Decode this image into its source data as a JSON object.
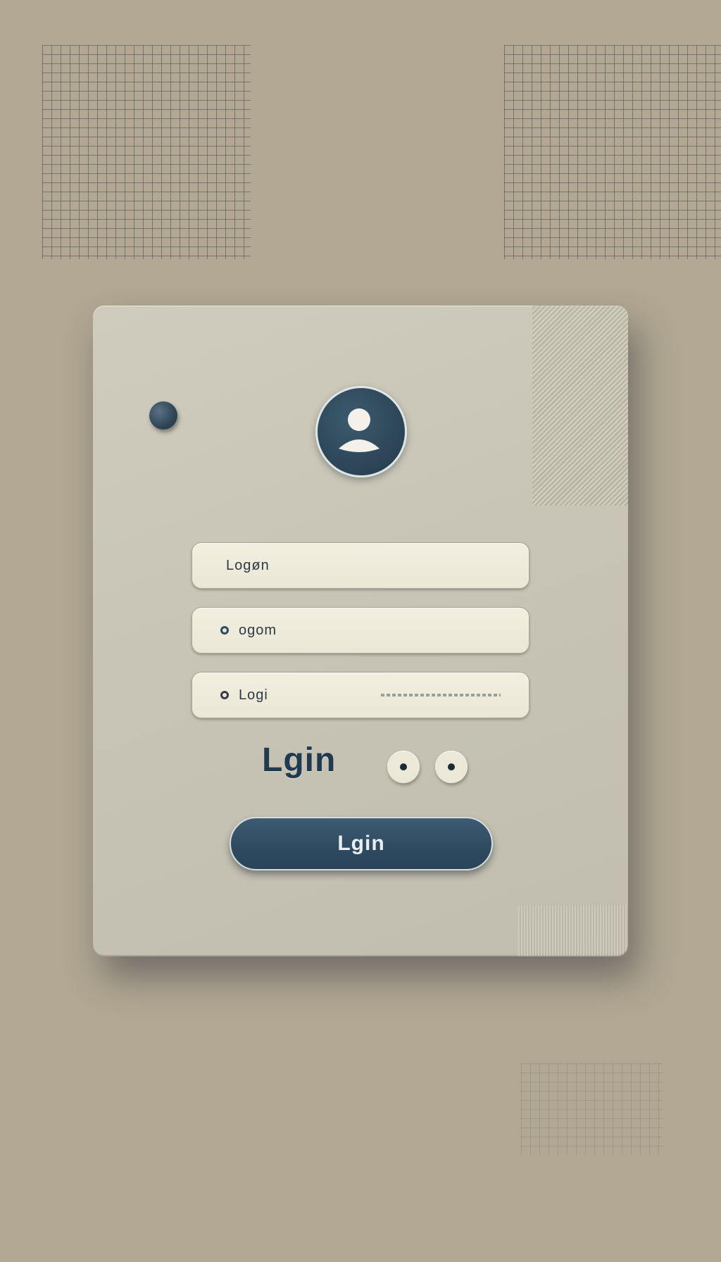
{
  "background": {
    "color": "#b1a792"
  },
  "card": {
    "avatar_icon": "user-icon",
    "fields": [
      {
        "value": "Logøn"
      },
      {
        "value": "ogom"
      },
      {
        "value": "Logi"
      }
    ],
    "heading": "Lgin",
    "login_button": "Lgin"
  },
  "colors": {
    "accent": "#2e4a60",
    "field": "#efecdc",
    "card": "#c9c6b7"
  }
}
